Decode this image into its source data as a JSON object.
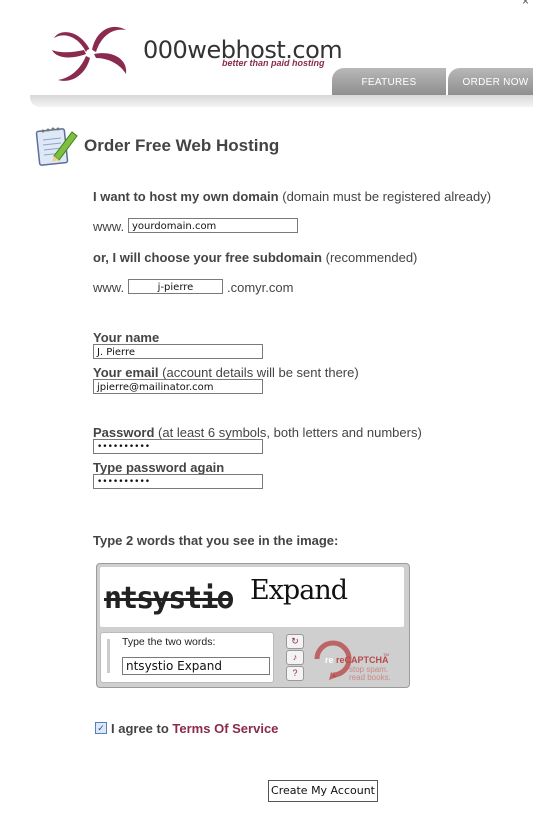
{
  "brand": {
    "name": "000webhost.com",
    "tagline": "better than paid hosting",
    "accent_color": "#8a2a4e"
  },
  "nav": {
    "tabs": [
      {
        "label": "FEATURES"
      },
      {
        "label": "ORDER NOW"
      }
    ]
  },
  "page": {
    "title": "Order Free Web Hosting"
  },
  "domain": {
    "own_label_bold": "I want to host my own domain",
    "own_label_rest": "(domain must be registered already)",
    "www_prefix": "www.",
    "own_value": "yourdomain.com",
    "sub_label_bold": "or, I will choose your free subdomain",
    "sub_label_rest": "(recommended)",
    "sub_value": "j-pierre",
    "sub_suffix": ".comyr.com"
  },
  "account": {
    "name_label": "Your name",
    "name_value": "J. Pierre",
    "email_label_bold": "Your email",
    "email_label_rest": "(account details will be sent there)",
    "email_value": "jpierre@mailinator.com",
    "password_label_bold": "Password",
    "password_label_rest": "(at least 6 symbols, both letters and numbers)",
    "password_value": "••••••••••",
    "password2_label": "Type password again",
    "password2_value": "••••••••••"
  },
  "captcha": {
    "label": "Type 2 words that you see in the image:",
    "word1": "ntsystio",
    "word2": "Expand",
    "prompt": "Type the two words:",
    "value": "ntsystio Expand",
    "logo_text": "reCAPTCHA",
    "logo_tm": "TM",
    "slogan1": "stop spam.",
    "slogan2": "read books."
  },
  "terms": {
    "prefix": "I agree to",
    "link": "Terms Of Service",
    "checked": true
  },
  "submit_label": "Create My Account"
}
